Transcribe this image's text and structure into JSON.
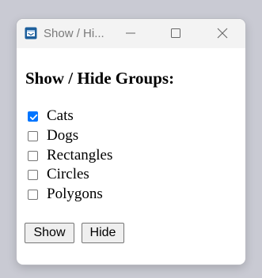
{
  "window": {
    "title": "Show / Hi...",
    "icon": "app-window-icon",
    "controls": [
      "minimize-icon",
      "maximize-icon",
      "close-icon"
    ]
  },
  "heading": "Show / Hide Groups:",
  "checkboxes": [
    {
      "label": "Cats",
      "checked": true
    },
    {
      "label": "Dogs",
      "checked": false
    },
    {
      "label": "Rectangles",
      "checked": false
    },
    {
      "label": "Circles",
      "checked": false
    },
    {
      "label": "Polygons",
      "checked": false
    }
  ],
  "buttons": {
    "show_label": "Show",
    "hide_label": "Hide"
  },
  "colors": {
    "accent": "#0075ff",
    "desktop": "#c9cad3"
  }
}
